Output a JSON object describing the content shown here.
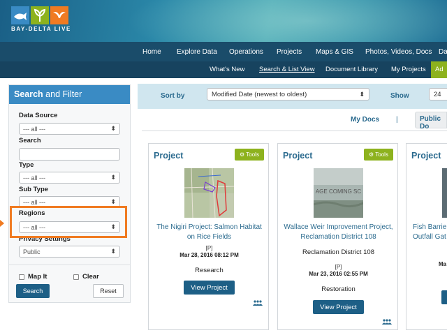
{
  "brand": {
    "logo_text": "BAY-DELTA LIVE",
    "colors": {
      "green": "#8db21e",
      "blue": "#3a8bc4",
      "orange": "#f07b22"
    }
  },
  "nav_primary": [
    "Home",
    "Explore Data",
    "Operations",
    "Projects",
    "Maps & GIS",
    "Photos, Videos, Docs",
    "Da"
  ],
  "nav_secondary": {
    "items": [
      "What's New",
      "Search & List View",
      "Document Library",
      "My Projects"
    ],
    "active": "Search & List View",
    "cut_item": "Ad"
  },
  "sidebar": {
    "title_bold": "Search",
    "title_rest": " and Filter",
    "data_source_label": "Data Source",
    "data_source_value": "--- all ---",
    "search_label": "Search",
    "type_label": "Type",
    "type_value": "--- all ---",
    "subtype_label": "Sub Type",
    "subtype_value": "--- all ---",
    "regions_label": "Regions",
    "regions_value": "--- all ---",
    "privacy_label": "Privacy Settings",
    "privacy_value": "Public",
    "mapit_label": "Map It",
    "clear_label": "Clear",
    "search_button": "Search",
    "reset_button": "Reset"
  },
  "sortbar": {
    "sort_label": "Sort by",
    "sort_value": "Modified Date (newest to oldest)",
    "show_label": "Show",
    "show_value": "24"
  },
  "doc_tabs": {
    "my_docs": "My Docs",
    "separator": "|",
    "public_docs": "Public Do"
  },
  "icons": {
    "tools": "gear-icon",
    "group": "people-icon",
    "caret": "updown-caret-icon"
  },
  "cards": [
    {
      "type": "Project",
      "tools": "Tools",
      "name_lines": [
        "The Nigiri Project: Salmon Habitat",
        "on Rice Fields"
      ],
      "code": "[P]",
      "date": "Mar 28, 2016 08:12 PM",
      "category": "Research",
      "button": "View Project"
    },
    {
      "type": "Project",
      "tools": "Tools",
      "image_text": "AGE COMING SC",
      "name_lines": [
        "Wallace Weir Improvement Project,",
        "Reclamation District 108"
      ],
      "org": "Reclamation District 108",
      "code": "[P]",
      "date": "Mar 23, 2016 02:55 PM",
      "category": "Restoration",
      "button": "View Project"
    },
    {
      "type": "Project",
      "name_lines": [
        "Fish Barrie",
        "Outfall Gat"
      ],
      "date_partial": "Ma"
    }
  ]
}
